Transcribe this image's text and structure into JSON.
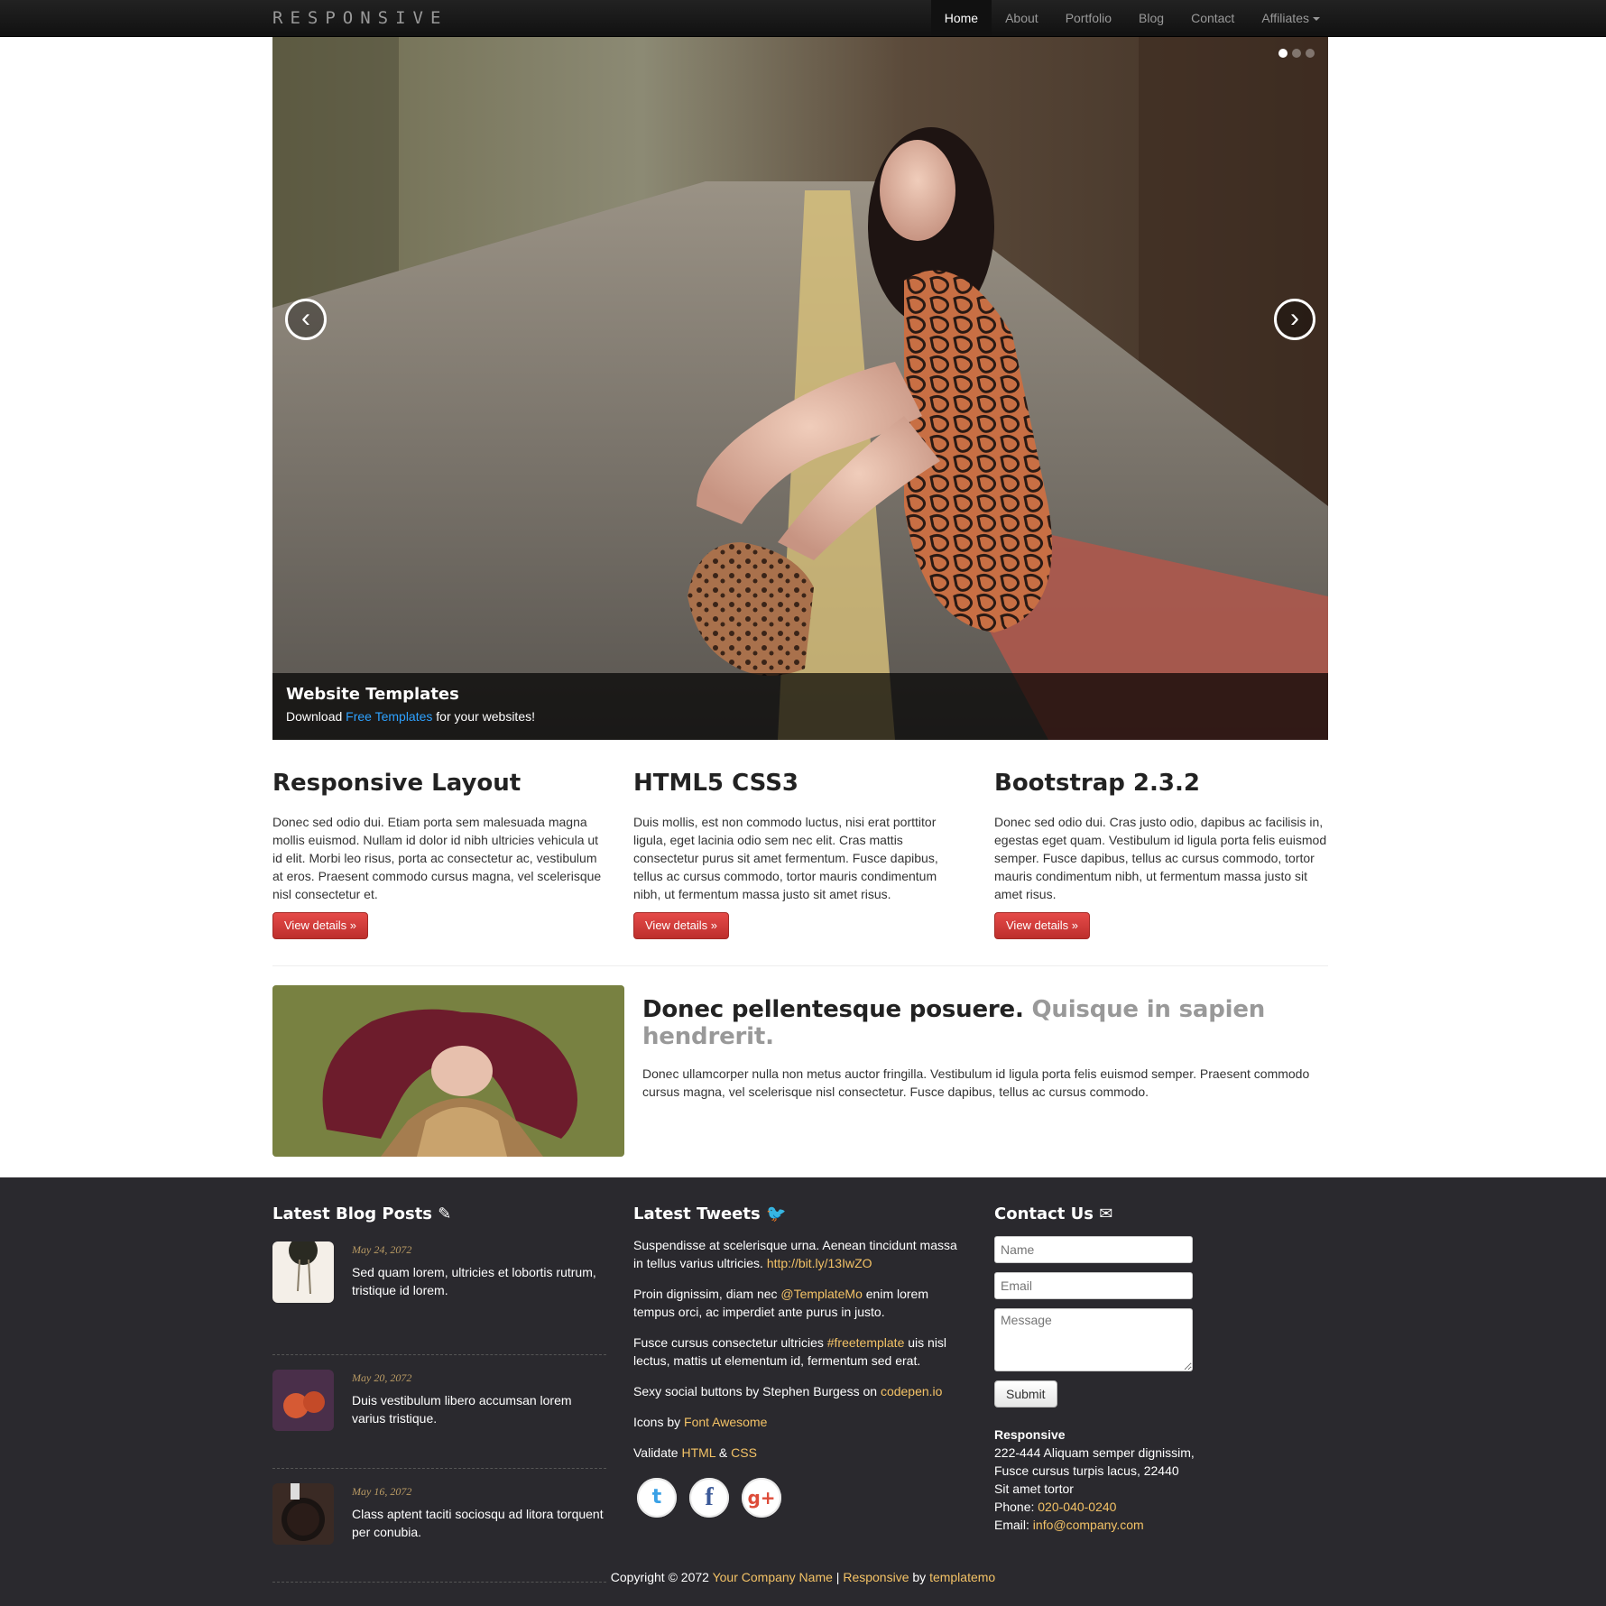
{
  "navbar": {
    "brand": "RESPONSIVE",
    "items": [
      {
        "label": "Home"
      },
      {
        "label": "About"
      },
      {
        "label": "Portfolio"
      },
      {
        "label": "Blog"
      },
      {
        "label": "Contact"
      },
      {
        "label": "Affiliates"
      }
    ]
  },
  "carousel": {
    "prev_glyph": "‹",
    "next_glyph": "›",
    "caption_title": "Website Templates",
    "caption_prefix": "Download ",
    "caption_link": "Free Templates",
    "caption_suffix": " for your websites!"
  },
  "features": [
    {
      "title": "Responsive Layout",
      "text": "Donec sed odio dui. Etiam porta sem malesuada magna mollis euismod. Nullam id dolor id nibh ultricies vehicula ut id elit. Morbi leo risus, porta ac consectetur ac, vestibulum at eros. Praesent commodo cursus magna, vel scelerisque nisl consectetur et.",
      "button": "View details »"
    },
    {
      "title": "HTML5 CSS3",
      "text": "Duis mollis, est non commodo luctus, nisi erat porttitor ligula, eget lacinia odio sem nec elit. Cras mattis consectetur purus sit amet fermentum. Fusce dapibus, tellus ac cursus commodo, tortor mauris condimentum nibh, ut fermentum massa justo sit amet risus.",
      "button": "View details »"
    },
    {
      "title": "Bootstrap 2.3.2",
      "text": "Donec sed odio dui. Cras justo odio, dapibus ac facilisis in, egestas eget quam. Vestibulum id ligula porta felis euismod semper. Fusce dapibus, tellus ac cursus commodo, tortor mauris condimentum nibh, ut fermentum massa justo sit amet risus.",
      "button": "View details »"
    }
  ],
  "featurette": {
    "heading": "Donec pellentesque posuere.",
    "heading_muted": "Quisque in sapien hendrerit.",
    "text": "Donec ullamcorper nulla non metus auctor fringilla. Vestibulum id ligula porta felis euismod semper. Praesent commodo cursus magna, vel scelerisque nisl consectetur. Fusce dapibus, tellus ac cursus commodo."
  },
  "footer": {
    "blog": {
      "title": "Latest Blog Posts",
      "posts": [
        {
          "date": "May 24, 2072",
          "text": "Sed quam lorem, ultricies et lobortis rutrum, tristique id lorem."
        },
        {
          "date": "May 20, 2072",
          "text": "Duis vestibulum libero accumsan lorem varius tristique."
        },
        {
          "date": "May 16, 2072",
          "text": "Class aptent taciti sociosqu ad litora torquent per conubia."
        }
      ]
    },
    "tweets": {
      "title": "Latest Tweets",
      "t1": "Suspendisse at scelerisque urna. Aenean tincidunt massa in tellus varius ultricies. ",
      "t1_link": "http://bit.ly/13IwZO",
      "t2_a": "Proin dignissim, diam nec ",
      "t2_link": "@TemplateMo",
      "t2_b": " enim lorem tempus orci, ac imperdiet ante purus in justo.",
      "t3_a": "Fusce cursus consectetur ultricies ",
      "t3_link": "#freetemplate",
      "t3_b": " uis nisl lectus, mattis ut elementum id, fermentum sed erat.",
      "t4_a": "Sexy social buttons by Stephen Burgess on ",
      "t4_link": "codepen.io",
      "t5_a": "Icons by ",
      "t5_link": "Font Awesome",
      "t6_a": "Validate ",
      "t6_link1": "HTML",
      "t6_mid": " & ",
      "t6_link2": "CSS"
    },
    "contact": {
      "title": "Contact Us",
      "name_placeholder": "Name",
      "email_placeholder": "Email",
      "message_placeholder": "Message",
      "submit": "Submit",
      "company": "Responsive",
      "address1": "222-444 Aliquam semper dignissim,",
      "address2": "Fusce cursus turpis lacus, 22440",
      "address3": "Sit amet tortor",
      "phone_label": "Phone:",
      "phone": "020-040-0240",
      "email_label": "Email:",
      "email": "info@company.com"
    },
    "copyright_prefix": "Copyright © 2072 ",
    "company_link": "Your Company Name",
    "sep": " | ",
    "responsive_link": "Responsive",
    "by": " by ",
    "templatemo_link": "templatemo"
  }
}
